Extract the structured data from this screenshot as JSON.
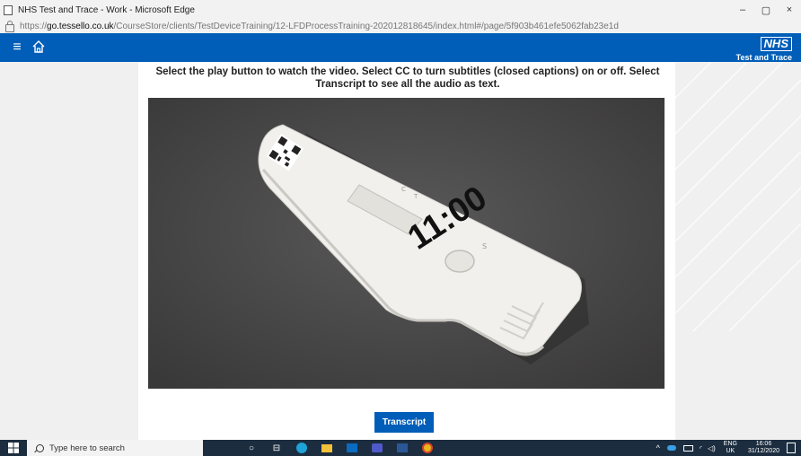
{
  "browser": {
    "window_title": "NHS Test and Trace - Work - Microsoft Edge",
    "url_prefix": "https://",
    "url_host": "go.tessello.co.uk",
    "url_path": "/CourseStore/clients/TestDeviceTraining/12-LFDProcessTraining-202012818645/index.html#/page/5f903b461efe5062fab23e1d",
    "controls": {
      "minimize": "–",
      "restore": "▢",
      "close": "×"
    }
  },
  "header": {
    "logo_text": "NHS",
    "logo_subtitle": "Test and Trace",
    "brand_color": "#005eb8"
  },
  "main": {
    "instructions": "Select the play button to watch the video. Select CC to turn subtitles (closed captions) on or off. Select Transcript to see all the audio as text.",
    "video": {
      "device_time_text": "11:00",
      "device_labels": [
        "C",
        "T",
        "S"
      ]
    },
    "transcript_label": "Transcript"
  },
  "taskbar": {
    "search_placeholder": "Type here to search",
    "language": "ENG",
    "region": "UK",
    "time": "16:06",
    "date": "31/12/2020"
  }
}
